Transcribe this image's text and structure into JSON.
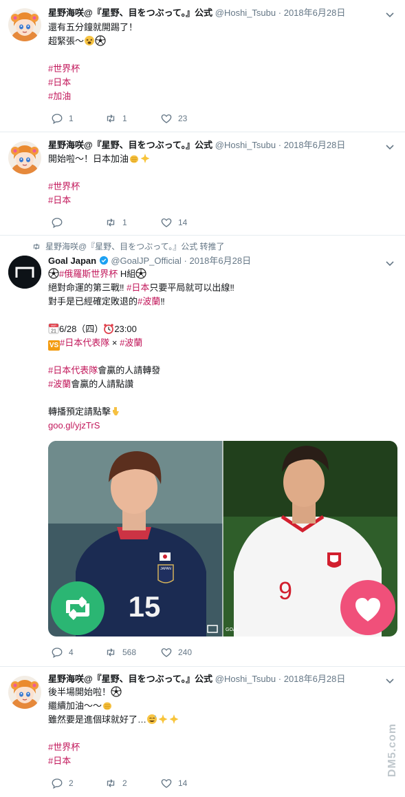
{
  "tweets": [
    {
      "name": "星野海咲@『星野、目をつぶって。』公式",
      "handle": "@Hoshi_Tsubu",
      "time": "2018年6月28日",
      "lines": [
        "還有五分鐘就開踢了！",
        "超緊張～"
      ],
      "tags": [
        "#世界杯",
        "#日本",
        "#加油"
      ],
      "reply": "1",
      "retweet": "1",
      "like": "23"
    },
    {
      "name": "星野海咲@『星野、目をつぶって。』公式",
      "handle": "@Hoshi_Tsubu",
      "time": "2018年6月28日",
      "lines": [
        "開始啦～！日本加油"
      ],
      "tags": [
        "#世界杯",
        "#日本"
      ],
      "reply": "",
      "retweet": "1",
      "like": "14"
    },
    {
      "retweeted_by": "星野海咲@『星野、目をつぶって。』公式 转推了",
      "name": "Goal Japan",
      "handle": "@GoalJP_Official",
      "time": "2018年6月28日",
      "l1_tag": "#俄羅斯世界杯",
      "l1_text": " H組",
      "l2_text": "絕對命運的第三戰‼ ",
      "l2_tag": "#日本",
      "l2_text2": "只要平局就可以出線‼",
      "l3_text": "對手是已經確定敗退的",
      "l3_tag": "#波蘭",
      "l3_text2": "‼",
      "l4_date": "6/28（四）",
      "l4_time": "23:00",
      "cal_month": "MAR",
      "cal_day": "21",
      "l5_tag1": "#日本代表隊",
      "l5_x": " × ",
      "l5_tag2": "#波蘭",
      "l6_tag": "#日本代表隊",
      "l6_text": "會贏的人請轉發",
      "l7_tag": "#波蘭",
      "l7_text": "會贏的人請點讚",
      "l8_text": "轉播預定請點擊",
      "link": "goo.gl/yjzTrS",
      "vs_label": "VS",
      "media_tag": "GOAL",
      "jersey_left": "15",
      "jersey_right": "9",
      "crest_text": "JAPAN",
      "reply": "4",
      "retweet": "568",
      "like": "240"
    },
    {
      "name": "星野海咲@『星野、目をつぶって。』公式",
      "handle": "@Hoshi_Tsubu",
      "time": "2018年6月28日",
      "lines": [
        "後半場開始啦！",
        "繼續加油～～",
        "雖然要是進個球就好了…"
      ],
      "tags": [
        "#世界杯",
        "#日本"
      ],
      "reply": "2",
      "retweet": "2",
      "like": "14"
    }
  ],
  "watermark": "DM5.com",
  "colors": {
    "tag": "#c2185b",
    "muted": "#657786",
    "retweet_green": "#2bb673",
    "like_pink": "#f0507a"
  }
}
